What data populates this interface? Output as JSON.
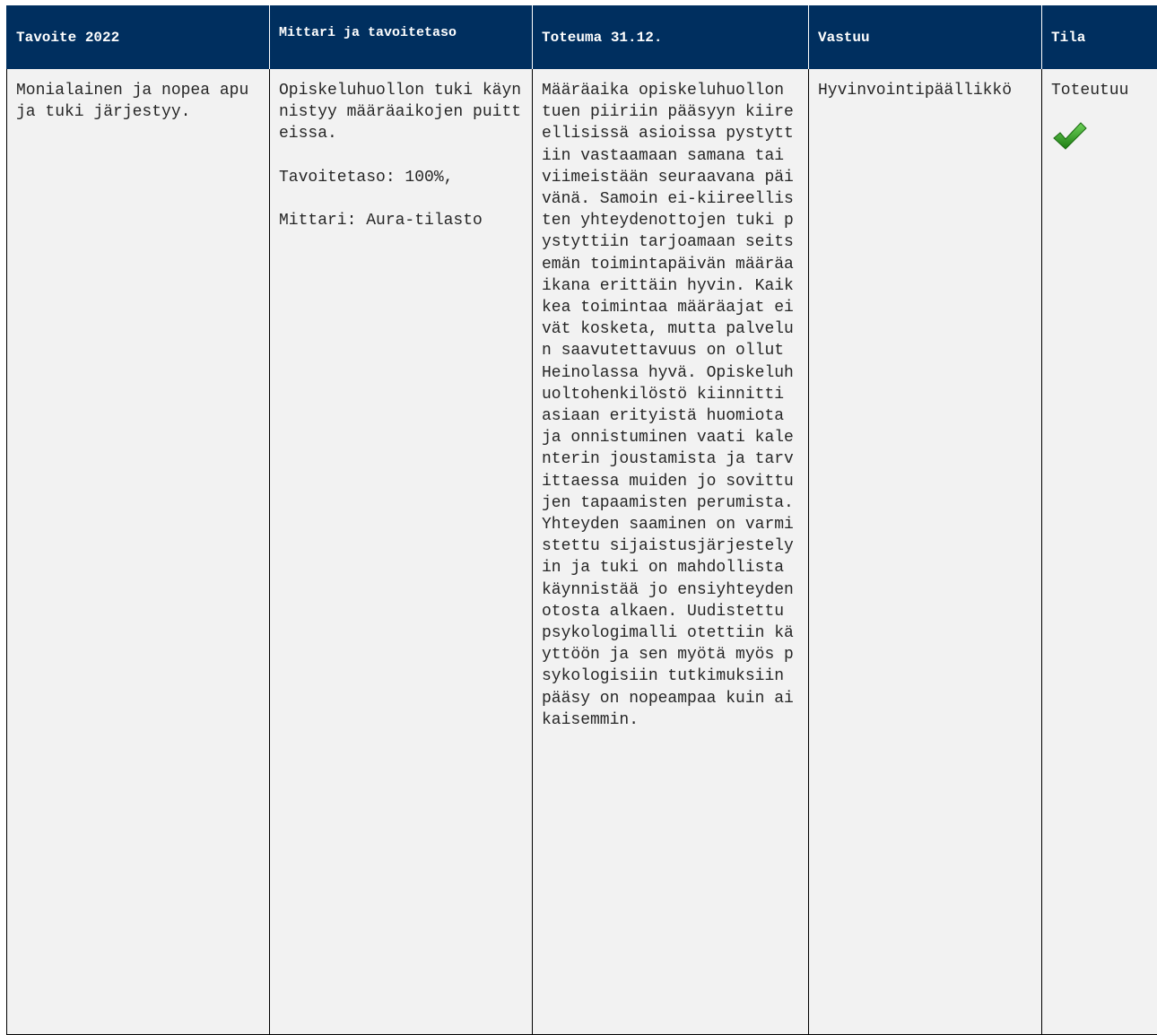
{
  "header": {
    "col1": "Tavoite 2022",
    "col2": "Mittari ja tavoitetaso",
    "col3": "Toteuma 31.12.",
    "col4": "Vastuu",
    "col5": "Tila"
  },
  "row": {
    "goal": "Monialainen ja nopea apu ja tuki järjestyy.",
    "metric_description": "Opiskeluhuollon tuki käynnistyy määräaikojen puitteissa.",
    "target_level": "Tavoitetaso: 100%,",
    "metric_source": "Mittari: Aura-tilasto",
    "outcome": "Määräaika opiskeluhuollon tuen piiriin pääsyyn kiireellisissä asioissa pystyttiin vastaamaan samana tai viimeistään seuraavana päivänä. Samoin ei-kiireellisten yhteydenottojen tuki pystyttiin tarjoamaan seitsemän toimintapäivän määräaikana erittäin hyvin. Kaikkea toimintaa määräajat eivät kosketa, mutta palvelun saavutettavuus on ollut Heinolassa hyvä. Opiskeluhuoltohenkilöstö kiinnitti asiaan erityistä huomiota ja onnistuminen vaati kalenterin joustamista ja tarvittaessa muiden jo sovittujen tapaamisten perumista.Yhteyden saaminen on varmistettu sijaistusjärjestelyin ja tuki on mahdollista käynnistää jo ensiyhteydenotosta alkaen. Uudistettu psykologimalli otettiin käyttöön ja sen myötä myös psykologisiin tutkimuksiin pääsy on nopeampaa kuin aikaisemmin.",
    "responsible": "Hyvinvointipäällikkö",
    "status": "Toteutuu",
    "status_icon": "green-check-icon"
  },
  "colors": {
    "header_bg": "#002f5f",
    "cell_bg": "#f2f2f2",
    "check_green": "#2e9e1f"
  }
}
